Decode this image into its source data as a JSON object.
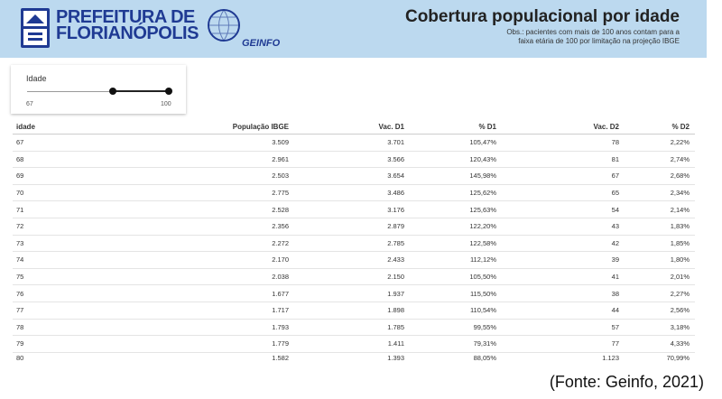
{
  "header": {
    "logo_line1": "PREFEITURA DE",
    "logo_line2": "FLORIANÓPOLIS",
    "geinfo_label": "GEINFO",
    "title": "Cobertura populacional por idade",
    "obs_line1": "Obs.: pacientes com mais de 100 anos contam para a",
    "obs_line2": "faixa etária de 100 por limitação na projeção IBGE"
  },
  "slider": {
    "label": "Idade",
    "min": "67",
    "max": "100"
  },
  "table": {
    "columns": [
      "idade",
      "População IBGE",
      "Vac. D1",
      "% D1",
      "Vac. D2",
      "% D2"
    ],
    "rows": [
      [
        "67",
        "3.509",
        "3.701",
        "105,47%",
        "78",
        "2,22%"
      ],
      [
        "68",
        "2.961",
        "3.566",
        "120,43%",
        "81",
        "2,74%"
      ],
      [
        "69",
        "2.503",
        "3.654",
        "145,98%",
        "67",
        "2,68%"
      ],
      [
        "70",
        "2.775",
        "3.486",
        "125,62%",
        "65",
        "2,34%"
      ],
      [
        "71",
        "2.528",
        "3.176",
        "125,63%",
        "54",
        "2,14%"
      ],
      [
        "72",
        "2.356",
        "2.879",
        "122,20%",
        "43",
        "1,83%"
      ],
      [
        "73",
        "2.272",
        "2.785",
        "122,58%",
        "42",
        "1,85%"
      ],
      [
        "74",
        "2.170",
        "2.433",
        "112,12%",
        "39",
        "1,80%"
      ],
      [
        "75",
        "2.038",
        "2.150",
        "105,50%",
        "41",
        "2,01%"
      ],
      [
        "76",
        "1.677",
        "1.937",
        "115,50%",
        "38",
        "2,27%"
      ],
      [
        "77",
        "1.717",
        "1.898",
        "110,54%",
        "44",
        "2,56%"
      ],
      [
        "78",
        "1.793",
        "1.785",
        "99,55%",
        "57",
        "3,18%"
      ],
      [
        "79",
        "1.779",
        "1.411",
        "79,31%",
        "77",
        "4,33%"
      ],
      [
        "80",
        "1.582",
        "1.393",
        "88,05%",
        "1.123",
        "70,99%"
      ]
    ]
  },
  "source": "(Fonte: Geinfo, 2021)",
  "colors": {
    "header_bg": "#bcd9ef",
    "brand_blue": "#1f3a93"
  }
}
